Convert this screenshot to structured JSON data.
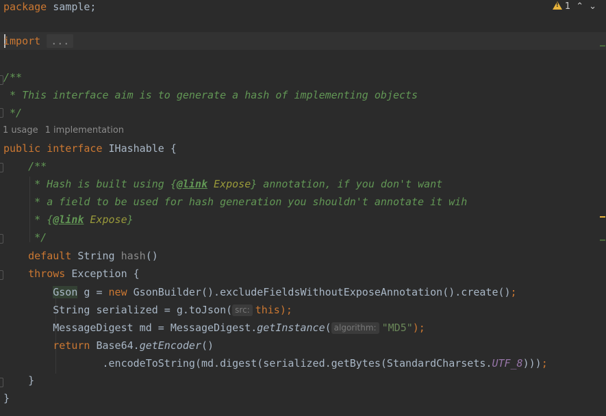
{
  "header": {
    "warning_count": "1",
    "nav_up": "^",
    "nav_down": "v"
  },
  "lines": {
    "package_kw": "package",
    "package_name": " sample;",
    "import_kw": "import",
    "import_folded": "...",
    "doc1_open": "/**",
    "doc1_body": " * This interface aim is to generate a hash of implementing objects",
    "doc1_close": " */",
    "usage_count": "1 usage",
    "impl_count": "1 implementation",
    "decl_public": "public",
    "decl_interface": "interface",
    "decl_rest": " IHashable {",
    "doc2_open": "    /**",
    "doc2_l1_a": "     * Hash is built using {",
    "doc2_l1_tag": "@link",
    "doc2_l1_ref": " Expose",
    "doc2_l1_b": "} annotation, if you don't want",
    "doc2_l2": "     * a field to be used for hash generation you shouldn't annotate it wih",
    "doc2_l3_a": "     * {",
    "doc2_l3_tag": "@link",
    "doc2_l3_ref": " Expose",
    "doc2_l3_b": "}",
    "doc2_close": "     */",
    "method_default": "    default",
    "method_type": " String ",
    "method_name": "hash",
    "method_parens": "()",
    "throws_kw": "    throws",
    "throws_rest": " Exception {",
    "l1_indent": "        ",
    "l1_gson": "Gson",
    "l1_a": " g = ",
    "l1_new": "new",
    "l1_b": " GsonBuilder().excludeFieldsWithoutExposeAnnotation().create()",
    "l1_semi": ";",
    "l2_a": "        String serialized = g.toJson(",
    "l2_hint": "src:",
    "l2_this": "this",
    "l2_b": ");",
    "l3_a": "        MessageDigest md = MessageDigest.",
    "l3_static": "getInstance",
    "l3_paren": "(",
    "l3_hint": "algorithm:",
    "l3_str": "\"MD5\"",
    "l3_b": ");",
    "l4_return": "        return",
    "l4_a": " Base64.",
    "l4_static": "getEncoder",
    "l4_b": "()",
    "l5_a": "                .encodeToString(md.digest(serialized.getBytes(StandardCharsets.",
    "l5_const": "UTF_8",
    "l5_b": ")))",
    "l5_semi": ";",
    "close_method": "    }",
    "close_interface": "}"
  },
  "colors": {
    "background": "#2b2b2b",
    "keyword": "#cc7832",
    "doc_comment": "#629755",
    "string": "#6a8759",
    "constant": "#9876aa",
    "warning": "#e8b33b"
  }
}
